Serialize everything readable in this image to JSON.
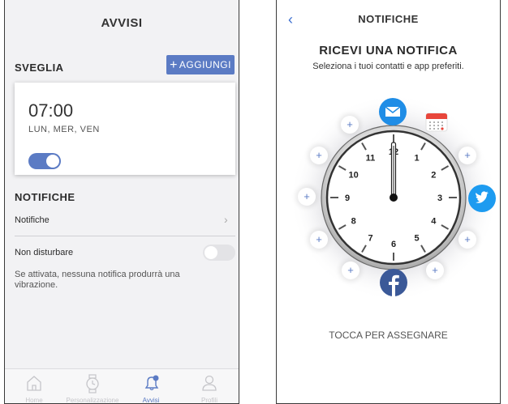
{
  "left": {
    "header_title": "AVVISI",
    "alarm_section": "SVEGLIA",
    "add_label": "AGGIUNGI",
    "add_plus": "+",
    "alarm_time": "07:00",
    "alarm_days": "LUN, MER, VEN",
    "alarm_enabled": true,
    "notifications_section": "NOTIFICHE",
    "notifications_row": "Notifiche",
    "chevron": "›",
    "dnd_row": "Non disturbare",
    "dnd_enabled": false,
    "dnd_description": "Se attivata, nessuna notifica produrrà una vibrazione.",
    "tabs": [
      {
        "label": "Home",
        "icon": "home-icon"
      },
      {
        "label": "Personalizzazione",
        "icon": "watch-icon"
      },
      {
        "label": "Avvisi",
        "icon": "bell-icon"
      },
      {
        "label": "Profili",
        "icon": "profile-icon"
      }
    ],
    "active_tab": "Avvisi"
  },
  "right": {
    "back_glyph": "‹",
    "header_title": "NOTIFICHE",
    "title": "RICEVI UNA NOTIFICA",
    "subtitle": "Seleziona i tuoi contatti e app preferiti.",
    "hint": "TOCCA PER ASSEGNARE",
    "plus_glyph": "+",
    "clock_numbers": [
      "12",
      "1",
      "2",
      "3",
      "4",
      "5",
      "6",
      "7",
      "8",
      "9",
      "10",
      "11"
    ],
    "assigned_apps": [
      {
        "name": "mail",
        "icon": "mail-icon",
        "color": "#1f8de6"
      },
      {
        "name": "calendar",
        "icon": "calendar-icon",
        "color": "#e8463b"
      },
      {
        "name": "twitter",
        "icon": "twitter-icon",
        "color": "#1d9bf0"
      },
      {
        "name": "facebook",
        "icon": "facebook-icon",
        "color": "#3b5998"
      }
    ]
  },
  "colors": {
    "accent": "#5b7bc4",
    "back_arrow": "#3c6fd0"
  }
}
